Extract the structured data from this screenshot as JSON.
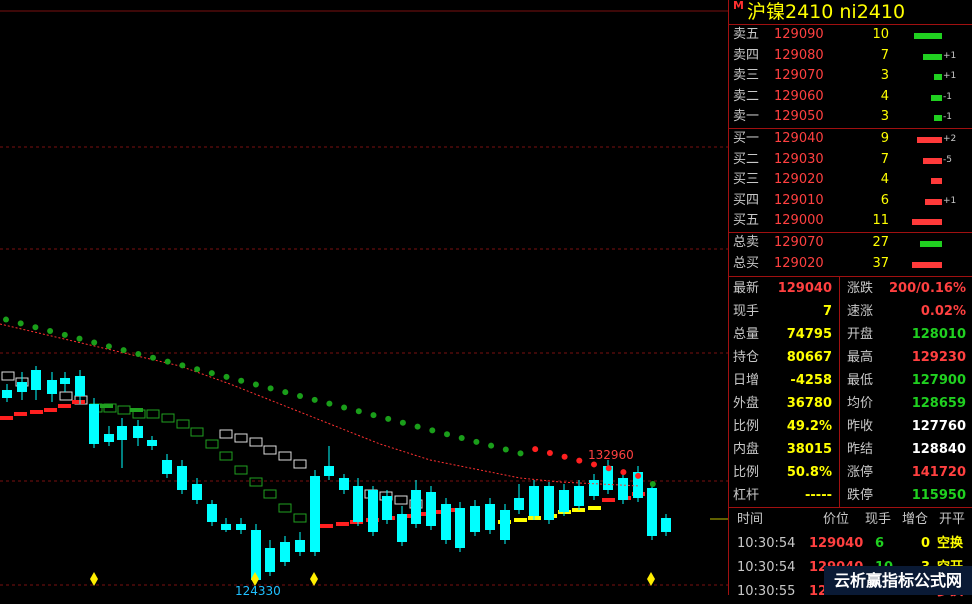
{
  "instrument": {
    "marker": "M",
    "title": "沪镍2410  ni2410"
  },
  "orderbook": {
    "asks": [
      {
        "label": "卖五",
        "price": "129090",
        "qty": "10",
        "change": "",
        "bar": 0.5,
        "color": "#20d020"
      },
      {
        "label": "卖四",
        "price": "129080",
        "qty": "7",
        "change": "+1",
        "bar": 0.35,
        "color": "#20d020"
      },
      {
        "label": "卖三",
        "price": "129070",
        "qty": "3",
        "change": "+1",
        "bar": 0.15,
        "color": "#20d020"
      },
      {
        "label": "卖二",
        "price": "129060",
        "qty": "4",
        "change": "-1",
        "bar": 0.2,
        "color": "#20d020"
      },
      {
        "label": "卖一",
        "price": "129050",
        "qty": "3",
        "change": "-1",
        "bar": 0.15,
        "color": "#20d020"
      }
    ],
    "bids": [
      {
        "label": "买一",
        "price": "129040",
        "qty": "9",
        "change": "+2",
        "bar": 0.45,
        "color": "#ff3a3a"
      },
      {
        "label": "买二",
        "price": "129030",
        "qty": "7",
        "change": "-5",
        "bar": 0.35,
        "color": "#ff3a3a"
      },
      {
        "label": "买三",
        "price": "129020",
        "qty": "4",
        "change": "",
        "bar": 0.2,
        "color": "#ff3a3a"
      },
      {
        "label": "买四",
        "price": "129010",
        "qty": "6",
        "change": "+1",
        "bar": 0.3,
        "color": "#ff3a3a"
      },
      {
        "label": "买五",
        "price": "129000",
        "qty": "11",
        "change": "",
        "bar": 0.55,
        "color": "#ff3a3a"
      }
    ],
    "totals": [
      {
        "label": "总卖",
        "price": "129070",
        "qty": "27",
        "change": "",
        "bar": 0.4,
        "color": "#20d020"
      },
      {
        "label": "总买",
        "price": "129020",
        "qty": "37",
        "change": "",
        "bar": 0.55,
        "color": "#ff3a3a"
      }
    ]
  },
  "quote": [
    {
      "l": "最新",
      "v": "129040",
      "vc": "#ff4040",
      "l2": "涨跌",
      "v2": "200/0.16%",
      "v2c": "#ff4040"
    },
    {
      "l": "现手",
      "v": "7",
      "vc": "#ffff00",
      "l2": "速涨",
      "v2": "0.02%",
      "v2c": "#ff4040"
    },
    {
      "l": "总量",
      "v": "74795",
      "vc": "#ffff00",
      "l2": "开盘",
      "v2": "128010",
      "v2c": "#20d020"
    },
    {
      "l": "持仓",
      "v": "80667",
      "vc": "#ffff00",
      "l2": "最高",
      "v2": "129230",
      "v2c": "#ff4040"
    },
    {
      "l": "日增",
      "v": "-4258",
      "vc": "#ffff00",
      "l2": "最低",
      "v2": "127900",
      "v2c": "#20d020"
    },
    {
      "l": "外盘",
      "v": "36780",
      "vc": "#ffff00",
      "l2": "均价",
      "v2": "128659",
      "v2c": "#20d020"
    },
    {
      "l": "比例",
      "v": "49.2%",
      "vc": "#ffff00",
      "l2": "昨收",
      "v2": "127760",
      "v2c": "#ffffff"
    },
    {
      "l": "内盘",
      "v": "38015",
      "vc": "#ffff00",
      "l2": "昨结",
      "v2": "128840",
      "v2c": "#ffffff"
    },
    {
      "l": "比例",
      "v": "50.8%",
      "vc": "#ffff00",
      "l2": "涨停",
      "v2": "141720",
      "v2c": "#ff4040"
    },
    {
      "l": "杠杆",
      "v": "-----",
      "vc": "#ffff00",
      "l2": "跌停",
      "v2": "115950",
      "v2c": "#20d020"
    }
  ],
  "ticks": {
    "headers": {
      "time": "时间",
      "price": "价位",
      "hand": "现手",
      "add": "增仓",
      "type": "开平"
    },
    "rows": [
      {
        "time": "10:30:54",
        "price": "129040",
        "hand": "6",
        "add": "0",
        "type": "空换",
        "tc": "#ffff00"
      },
      {
        "time": "10:30:54",
        "price": "129040",
        "hand": "10",
        "add": "3",
        "type": "空开",
        "tc": "#ffff00"
      },
      {
        "time": "10:30:55",
        "price": "129040",
        "hand": "",
        "add": "",
        "type": "多换",
        "tc": "#ff4040"
      }
    ]
  },
  "chart_labels": {
    "high": "132960",
    "low": "124330"
  },
  "watermark": "云析赢指标公式网",
  "colors": {
    "up": "#ff3030",
    "down": "#00ffff",
    "ma_red": "#ff3030",
    "dot_green": "#1a9e1a",
    "grid": "#7a1010"
  }
}
